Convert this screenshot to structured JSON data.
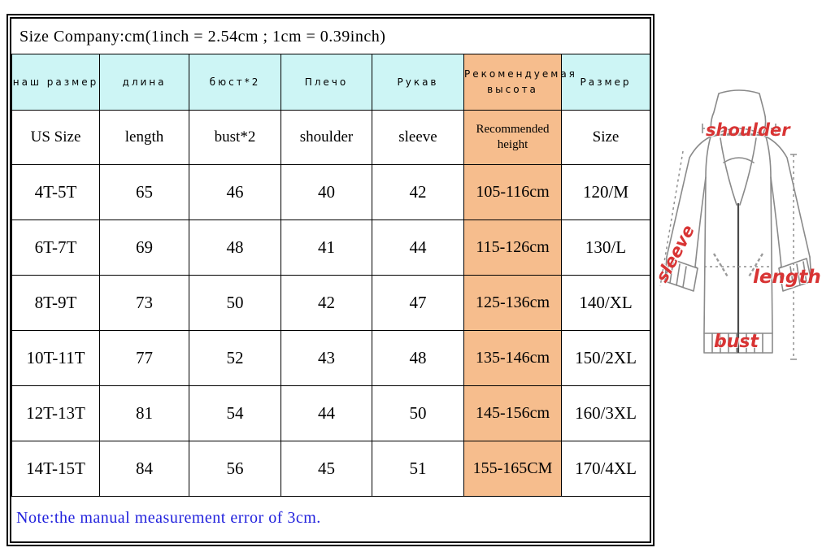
{
  "title": "Size Company:cm(1inch = 2.54cm ; 1cm = 0.39inch)",
  "note": "Note:the manual measurement error of 3cm.",
  "colors": {
    "header_cyan": "#CDF5F5",
    "highlight_peach": "#F6BD8D",
    "highlight_text_red": "#FF0000",
    "note_blue": "#2222DD",
    "illustration_label_red": "#D83434",
    "border": "#000000"
  },
  "table": {
    "headers_ru": [
      "наш размер",
      "длина",
      "бюст*2",
      "Плечо",
      "Рукав",
      "Рекомендуемая высота",
      "Размер"
    ],
    "headers_en": [
      "US Size",
      "length",
      "bust*2",
      "shoulder",
      "sleeve",
      "Recommended height",
      "Size"
    ],
    "highlight_column_index": 5,
    "rows": [
      {
        "us_size": "4T-5T",
        "length": "65",
        "bust2": "46",
        "shoulder": "40",
        "sleeve": "42",
        "recommended_height": "105-116cm",
        "size": "120/M"
      },
      {
        "us_size": "6T-7T",
        "length": "69",
        "bust2": "48",
        "shoulder": "41",
        "sleeve": "44",
        "recommended_height": "115-126cm",
        "size": "130/L"
      },
      {
        "us_size": "8T-9T",
        "length": "73",
        "bust2": "50",
        "shoulder": "42",
        "sleeve": "47",
        "recommended_height": "125-136cm",
        "size": "140/XL"
      },
      {
        "us_size": "10T-11T",
        "length": "77",
        "bust2": "52",
        "shoulder": "43",
        "sleeve": "48",
        "recommended_height": "135-146cm",
        "size": "150/2XL"
      },
      {
        "us_size": "12T-13T",
        "length": "81",
        "bust2": "54",
        "shoulder": "44",
        "sleeve": "50",
        "recommended_height": "145-156cm",
        "size": "160/3XL"
      },
      {
        "us_size": "14T-15T",
        "length": "84",
        "bust2": "56",
        "shoulder": "45",
        "sleeve": "51",
        "recommended_height": "155-165CM",
        "size": "170/4XL"
      }
    ]
  },
  "illustration": {
    "garment": "hooded-jacket",
    "labels": {
      "shoulder": "shoulder",
      "length": "length",
      "bust": "bust",
      "sleeve": "sleeve"
    }
  }
}
